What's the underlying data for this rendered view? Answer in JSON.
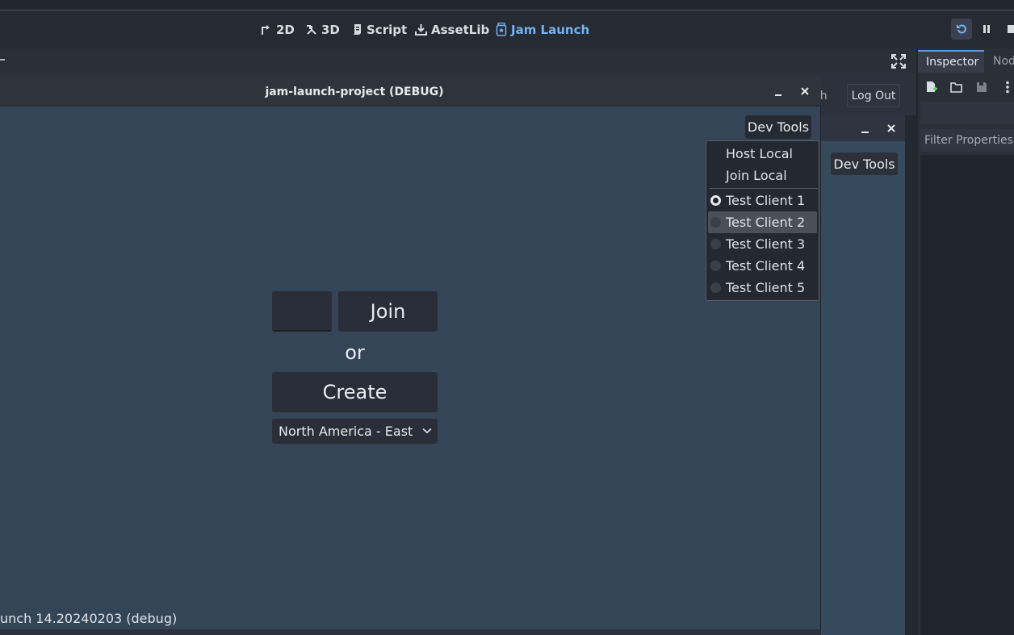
{
  "toolbar": {
    "workspaces": [
      {
        "label": "2D",
        "icon": "2d-icon"
      },
      {
        "label": "3D",
        "icon": "3d-icon"
      },
      {
        "label": "Script",
        "icon": "script-icon"
      },
      {
        "label": "AssetLib",
        "icon": "assetlib-icon"
      },
      {
        "label": "Jam Launch",
        "icon": "jam-launch-icon",
        "active": true
      }
    ],
    "accent_color": "#73b4f2"
  },
  "background_window": {
    "partial_button_label": "ch",
    "logout_label": "Log Out",
    "devtools_label": "Dev Tools"
  },
  "inspector": {
    "tabs": [
      "Inspector",
      "Node"
    ],
    "filter_placeholder": "Filter Properties"
  },
  "game_window": {
    "title": "jam-launch-project (DEBUG)",
    "join_label": "Join",
    "or_label": "or",
    "create_label": "Create",
    "region_selected": "North America - East",
    "devtools_label": "Dev Tools",
    "version": "unch 14.20240203 (debug)",
    "background_color": "#344558"
  },
  "dev_menu": {
    "actions": [
      "Host Local",
      "Join Local"
    ],
    "clients": [
      {
        "label": "Test Client 1",
        "checked": true
      },
      {
        "label": "Test Client 2",
        "checked": false,
        "hovered": true
      },
      {
        "label": "Test Client 3",
        "checked": false
      },
      {
        "label": "Test Client 4",
        "checked": false
      },
      {
        "label": "Test Client 5",
        "checked": false
      }
    ]
  }
}
